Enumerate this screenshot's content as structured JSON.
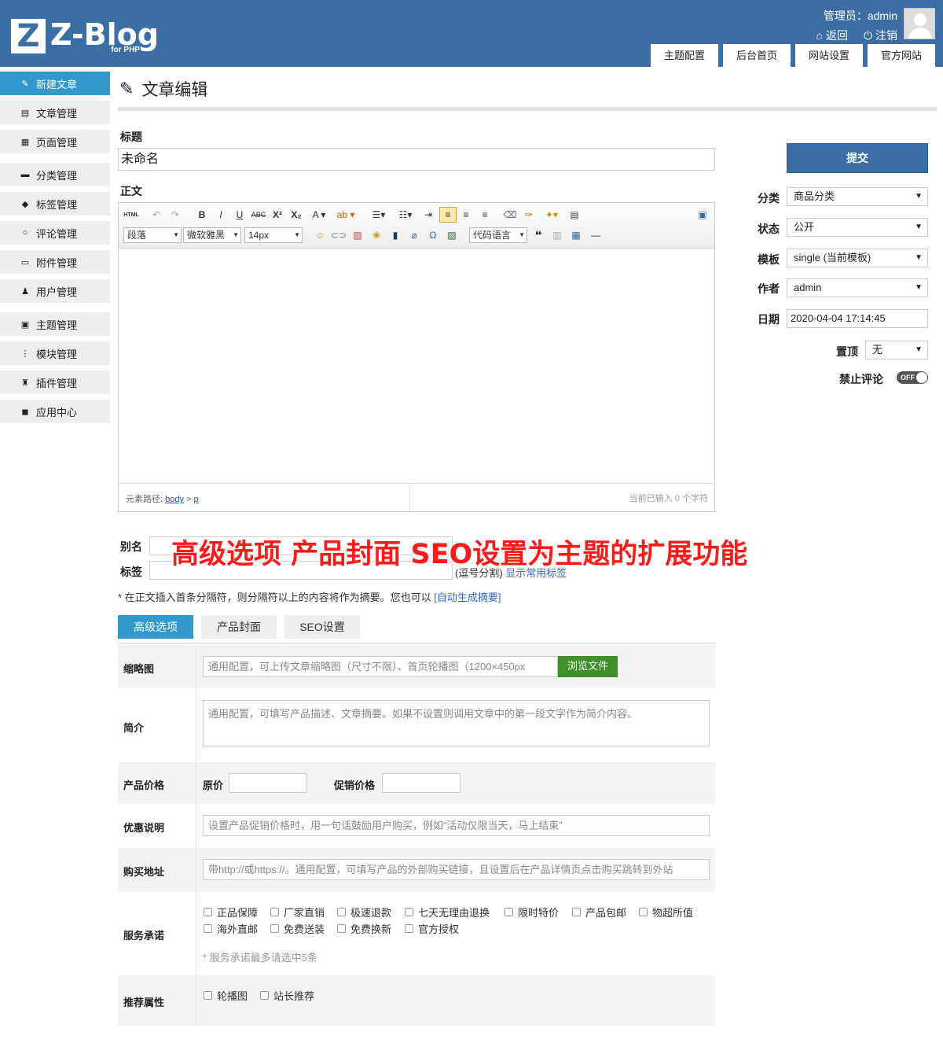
{
  "header": {
    "logo_letter": "Z",
    "logo_text": "Z-Blog",
    "logo_sub": "for PHP",
    "admin_text": "管理员：admin",
    "back_label": "返回",
    "logout_label": "注销",
    "tabs": [
      "主题配置",
      "后台首页",
      "网站设置",
      "官方网站"
    ]
  },
  "sidebar": {
    "items": [
      {
        "label": "新建文章",
        "icon": "pencil-square-icon"
      },
      {
        "label": "文章管理",
        "icon": "file-text-icon"
      },
      {
        "label": "页面管理",
        "icon": "files-icon"
      },
      {
        "label": "分类管理",
        "icon": "folder-icon"
      },
      {
        "label": "标签管理",
        "icon": "tag-icon"
      },
      {
        "label": "评论管理",
        "icon": "chat-icon"
      },
      {
        "label": "附件管理",
        "icon": "printer-icon"
      },
      {
        "label": "用户管理",
        "icon": "person-icon"
      },
      {
        "label": "主题管理",
        "icon": "layout-icon"
      },
      {
        "label": "模块管理",
        "icon": "modules-icon"
      },
      {
        "label": "插件管理",
        "icon": "plug-icon"
      },
      {
        "label": "应用中心",
        "icon": "box-icon"
      }
    ]
  },
  "page_title": "文章编辑",
  "form": {
    "title_label": "标题",
    "title_value": "未命名",
    "body_label": "正文",
    "alias_label": "别名",
    "tags_label": "标签",
    "tags_hint_prefix": "(逗号分割)",
    "tags_hint_link": "显示常用标签",
    "summary_hint_prefix": "* 在正文插入首条分隔符，则分隔符以上的内容将作为摘要。您也可以",
    "summary_hint_link": "[自动生成摘要]"
  },
  "editor": {
    "paragraph": "段落",
    "font": "微软雅黑",
    "size": "14px",
    "code_lang": "代码语言",
    "path_label": "元素路径:",
    "path_body": "body",
    "path_sep": ">",
    "path_p": "p",
    "char_count": "当前已输入 0 个字符"
  },
  "banner_text": "高级选项  产品封面  SEO设置为主题的扩展功能",
  "sidepanel": {
    "submit_label": "提交",
    "category_label": "分类",
    "category_value": "商品分类",
    "status_label": "状态",
    "status_value": "公开",
    "template_label": "模板",
    "template_value": "single (当前模板)",
    "author_label": "作者",
    "author_value": "admin",
    "date_label": "日期",
    "date_value": "2020-04-04 17:14:45",
    "top_label": "置顶",
    "top_value": "无",
    "nocomment_label": "禁止评论",
    "toggle_text": "OFF"
  },
  "tabs": [
    "高级选项",
    "产品封面",
    "SEO设置"
  ],
  "advanced": {
    "thumb_label": "缩略图",
    "thumb_placeholder": "通用配置，可上传文章缩略图（尺寸不限）、首页轮播图（1200×450px",
    "browse_label": "浏览文件",
    "intro_label": "简介",
    "intro_placeholder": "通用配置，可填写产品描述、文章摘要。如果不设置则调用文章中的第一段文字作为简介内容。",
    "price_label": "产品价格",
    "orig_price_label": "原价",
    "sale_price_label": "促销价格",
    "promo_label": "优惠说明",
    "promo_placeholder": "设置产品促销价格时，用一句话鼓励用户购买，例如“活动仅限当天，马上结束”",
    "buy_label": "购买地址",
    "buy_placeholder": "带http://或https://。通用配置，可填写产品的外部购买链接，且设置后在产品详情页点击购买跳转到外站",
    "service_label": "服务承诺",
    "services_row1": [
      "正品保障",
      "厂家直销",
      "极速退款",
      "七天无理由退换",
      "限时特价",
      "产品包邮",
      "物超所值"
    ],
    "services_row2": [
      "海外直邮",
      "免费送装",
      "免费换新",
      "官方授权"
    ],
    "service_note": "* 服务承诺最多请选中5条",
    "recommend_label": "推荐属性",
    "recommend": [
      "轮播图",
      "站长推荐"
    ]
  },
  "colors": {
    "header_bg": "#3a6ea5",
    "sidebar_active": "#3399cc",
    "tab_active": "#3399cc",
    "browse_green": "#3f8f2b",
    "banner_red": "#ff1a1a"
  }
}
